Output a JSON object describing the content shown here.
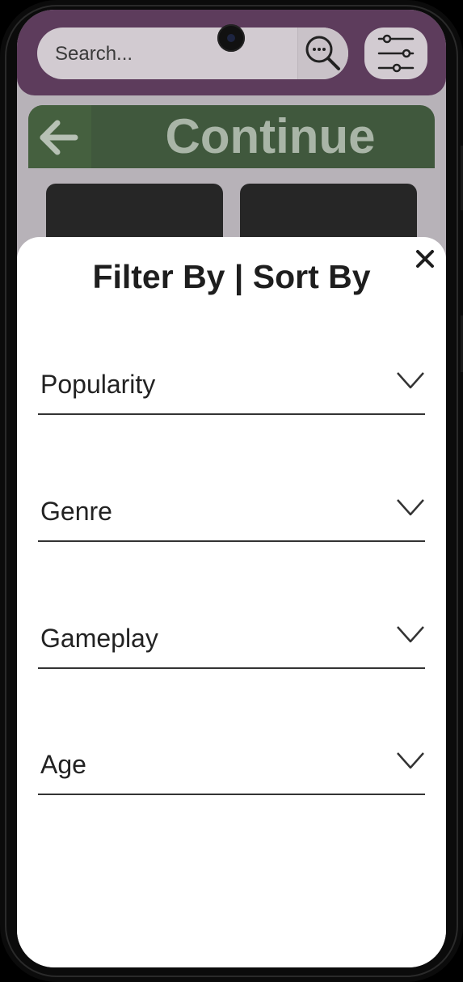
{
  "header": {
    "search": {
      "placeholder": "Search..."
    }
  },
  "continue_bar": {
    "label": "Continue"
  },
  "filter_sheet": {
    "title": "Filter By | Sort By",
    "options": [
      {
        "label": "Popularity"
      },
      {
        "label": "Genre"
      },
      {
        "label": "Gameplay"
      },
      {
        "label": "Age"
      }
    ]
  },
  "colors": {
    "topbar": "#5d3c5c",
    "continue_bar": "#40583d",
    "sheet": "#ffffff",
    "screen_overlay": "#b7b2b8"
  },
  "icons": {
    "search": "search-dots-icon",
    "filter": "sliders-icon",
    "back": "arrow-left-icon",
    "close": "close-icon",
    "chevron": "chevron-down-icon"
  }
}
